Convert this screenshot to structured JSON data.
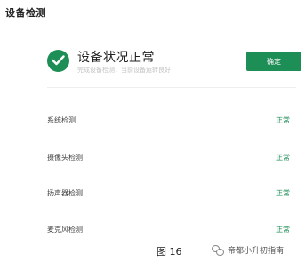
{
  "page": {
    "title": "设备检测"
  },
  "status": {
    "title": "设备状况正常",
    "subtitle": "完成设备检测，当前设备运转良好",
    "confirm_label": "确定",
    "icon": "check-circle-icon",
    "accent_color": "#1e8e57"
  },
  "checks": [
    {
      "label": "系统检测",
      "value": "正常"
    },
    {
      "label": "摄像头检测",
      "value": "正常"
    },
    {
      "label": "扬声器检测",
      "value": "正常"
    },
    {
      "label": "麦克风检测",
      "value": "正常"
    }
  ],
  "caption": "图 16",
  "watermark": {
    "icon": "wechat-icon",
    "text": "帝都小升初指南"
  }
}
